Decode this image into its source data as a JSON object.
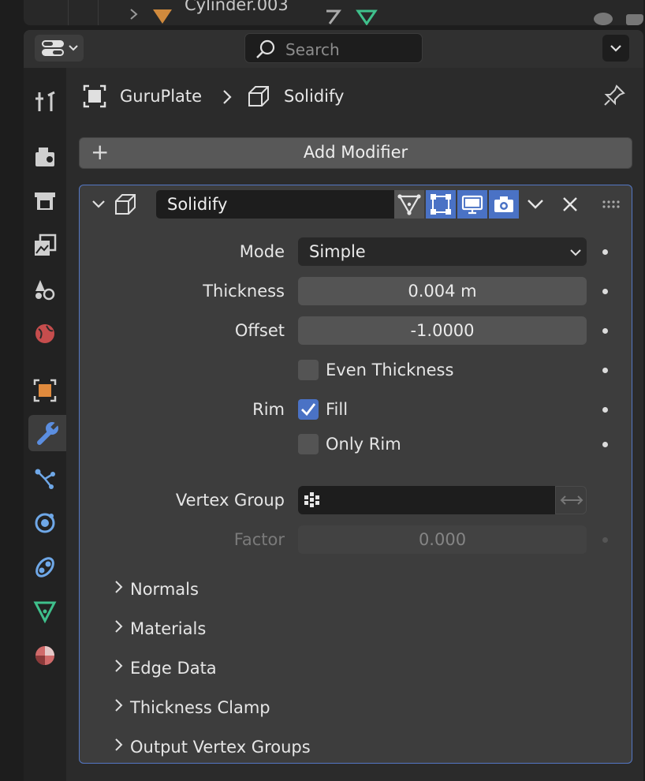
{
  "outliner": {
    "partial_item": "Cylinder.003"
  },
  "header": {
    "search_placeholder": "Search"
  },
  "breadcrumb": {
    "object": "GuruPlate",
    "modifier": "Solidify"
  },
  "add_modifier_label": "Add Modifier",
  "modifier": {
    "name": "Solidify",
    "properties": {
      "mode": {
        "label": "Mode",
        "value": "Simple"
      },
      "thickness": {
        "label": "Thickness",
        "value": "0.004 m"
      },
      "offset": {
        "label": "Offset",
        "value": "-1.0000"
      },
      "even_thickness": {
        "label": "Even Thickness",
        "checked": false
      },
      "rim": {
        "label": "Rim",
        "fill_label": "Fill",
        "fill_checked": true,
        "only_rim_label": "Only Rim",
        "only_rim_checked": false
      },
      "vertex_group": {
        "label": "Vertex Group",
        "value": ""
      },
      "factor": {
        "label": "Factor",
        "value": "0.000"
      }
    },
    "subpanels": [
      "Normals",
      "Materials",
      "Edge Data",
      "Thickness Clamp",
      "Output Vertex Groups"
    ]
  },
  "tabs": [
    "tool",
    "render",
    "output",
    "view-layer",
    "scene",
    "world",
    "object",
    "modifiers",
    "particles",
    "physics",
    "constraints",
    "data",
    "material"
  ],
  "active_tab": "modifiers",
  "colors": {
    "accent": "#4a72c5",
    "panel_outline": "#5477c4"
  }
}
